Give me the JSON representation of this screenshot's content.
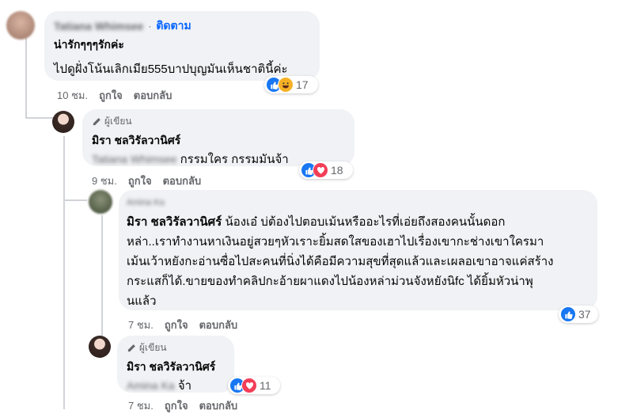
{
  "comment1": {
    "name_blurred": "Tatiana Whimsee",
    "follow_label": "ติดตาม",
    "line1": "น่ารักๆๆๆรักค่ะ",
    "line2": "ไปดูฝั่งโน้นเลิกเมีย555บาปบุญมันเห็นชาตินี้ค่ะ",
    "reaction_count": "17",
    "time": "10 ชม.",
    "like": "ถูกใจ",
    "reply": "ตอบกลับ"
  },
  "comment2": {
    "author_badge": "ผู้เขียน",
    "name": "มิรา ชลวิรัลวานิศร์",
    "mention_blurred": "Tatiana Whimsee",
    "text": "กรรมใคร กรรมมันจ้า",
    "reaction_count": "18",
    "time": "9 ชม.",
    "like": "ถูกใจ",
    "reply": "ตอบกลับ"
  },
  "comment3": {
    "name_blurred": "Amina Ka",
    "mention": "มิรา ชลวิรัลวานิศร์",
    "lines": [
      "น้องเอ๋ บ่ต้องไปตอบเม้นหรืออะไรที่เอ่ยถึงสองคนนั้นดอก",
      "หล่า..เราทำงานหาเงินอยู่สวยๆหัวเราะยิ้มสดใสของเฮาไปเรื่องเขากะช่างเขาใครมา",
      "เม้นเว้าหยังกะอ่านซื่อไปสะคนที่นิ่งได้คือมีความสุขที่สุดแล้วและเผลอเขาอาจแค่สร้าง",
      "กระแสก็ได้.ขายของทำคลิปกะอ้ายผาแดงไปน้องหล่าม่วนจังหยังนิfc ได้ยิ้มหัวน่าพุ",
      "นแล้ว"
    ],
    "reaction_count": "37",
    "time": "7 ชม.",
    "like": "ถูกใจ",
    "reply": "ตอบกลับ"
  },
  "comment4": {
    "author_badge": "ผู้เขียน",
    "name": "มิรา ชลวิรัลวานิศร์",
    "mention_blurred": "Amina Ka",
    "text": "จ้า",
    "reaction_count": "11",
    "time": "7 ชม.",
    "like": "ถูกใจ",
    "reply": "ตอบกลับ"
  },
  "colors": {
    "bubble": "#f0f2f5",
    "like_blue": "#1877f2",
    "love_red": "#f33e58",
    "haha_yellow": "#f7b125",
    "link_blue": "#0866ff"
  },
  "icons": [
    "like-icon",
    "haha-icon",
    "love-icon",
    "pencil-icon"
  ]
}
